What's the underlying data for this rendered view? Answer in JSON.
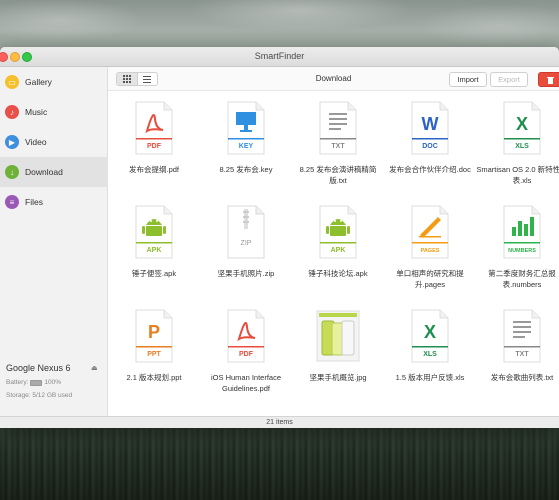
{
  "window": {
    "title": "SmartFinder"
  },
  "sidebar": {
    "items": [
      {
        "label": "Gallery",
        "color": "#f5c02b",
        "icon": "gallery-icon"
      },
      {
        "label": "Music",
        "color": "#e8504a",
        "icon": "music-icon"
      },
      {
        "label": "Video",
        "color": "#3e8fe0",
        "icon": "video-icon"
      },
      {
        "label": "Download",
        "color": "#6fb23a",
        "icon": "download-icon"
      },
      {
        "label": "Files",
        "color": "#9b59b6",
        "icon": "files-icon"
      }
    ],
    "active_index": 3,
    "device": {
      "name": "Google Nexus 6",
      "battery_label": "Battery:",
      "battery_value": "100%",
      "battery_level": 1.0,
      "storage": "Storage: 5/12 GB used"
    }
  },
  "toolbar": {
    "title": "Download",
    "import_label": "Import",
    "export_label": "Export"
  },
  "files": [
    {
      "name": "发布会提纲.pdf",
      "type": "PDF",
      "color": "#e74c3c"
    },
    {
      "name": "8.25 发布会.key",
      "type": "KEY",
      "color": "#2f8fe0"
    },
    {
      "name": "8.25 发布会演讲稿精简版.txt",
      "type": "TXT",
      "color": "#888888"
    },
    {
      "name": "发布会合作伙伴介绍.doc",
      "type": "DOC",
      "color": "#2b63c6"
    },
    {
      "name": "Smartisan OS 2.0 新特性列表.xls",
      "type": "XLS",
      "color": "#1f8f4e"
    },
    {
      "name": "锤子便签.apk",
      "type": "APK",
      "color": "#8cbf2b"
    },
    {
      "name": "坚果手机照片.zip",
      "type": "ZIP",
      "color": "#999999"
    },
    {
      "name": "锤子科技论坛.apk",
      "type": "APK",
      "color": "#8cbf2b"
    },
    {
      "name": "单口相声的研究和提升.pages",
      "type": "PAGES",
      "color": "#f39c12"
    },
    {
      "name": "第二季度财务汇总报表.numbers",
      "type": "NUMBERS",
      "color": "#2fb34a"
    },
    {
      "name": "2.1 版本规划.ppt",
      "type": "PPT",
      "color": "#e67e22"
    },
    {
      "name": "iOS Human Interface Guidelines.pdf",
      "type": "PDF",
      "color": "#e74c3c"
    },
    {
      "name": "坚果手机概览.jpg",
      "type": "JPG",
      "color": "#a8c93a"
    },
    {
      "name": "1.5 版本用户反馈.xls",
      "type": "XLS",
      "color": "#1f8f4e"
    },
    {
      "name": "发布会歌曲列表.txt",
      "type": "TXT",
      "color": "#888888"
    }
  ],
  "status": {
    "count": "21 items"
  }
}
